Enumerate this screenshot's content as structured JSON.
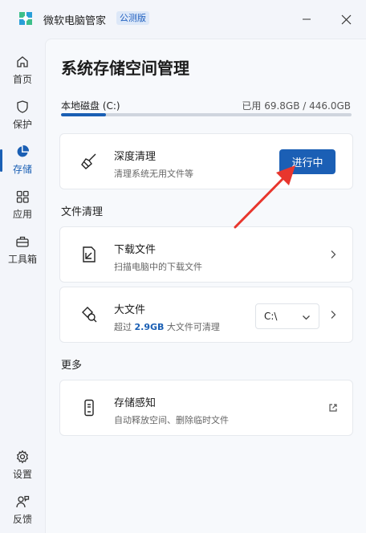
{
  "app": {
    "title": "微软电脑管家",
    "badge": "公测版"
  },
  "sidebar": {
    "items": [
      {
        "label": "首页",
        "icon": "home-icon"
      },
      {
        "label": "保护",
        "icon": "shield-icon"
      },
      {
        "label": "存储",
        "icon": "pie-chart-icon",
        "active": true
      },
      {
        "label": "应用",
        "icon": "apps-icon"
      },
      {
        "label": "工具箱",
        "icon": "toolbox-icon"
      }
    ],
    "bottom": [
      {
        "label": "设置",
        "icon": "gear-icon"
      },
      {
        "label": "反馈",
        "icon": "feedback-icon"
      }
    ]
  },
  "main": {
    "title": "系统存储空间管理",
    "disk": {
      "label": "本地磁盘 (C:)",
      "usage": "已用 69.8GB / 446.0GB",
      "used_fraction": 0.156
    },
    "deep_clean": {
      "title": "深度清理",
      "subtitle": "清理系统无用文件等",
      "button": "进行中"
    },
    "file_clean_label": "文件清理",
    "downloads": {
      "title": "下载文件",
      "subtitle": "扫描电脑中的下载文件"
    },
    "large_files": {
      "title": "大文件",
      "sub_prefix": "超过",
      "sub_size": "2.9GB",
      "sub_suffix": "大文件可清理",
      "drive": "C:\\"
    },
    "more_label": "更多",
    "storage_sense": {
      "title": "存储感知",
      "subtitle": "自动释放空间、删除临时文件"
    }
  },
  "colors": {
    "accent": "#1b5fb5",
    "annotation_arrow": "#e8362d"
  }
}
